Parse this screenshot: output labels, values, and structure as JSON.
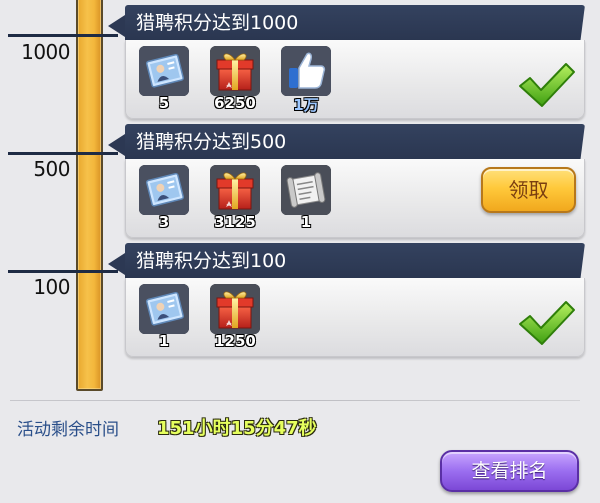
{
  "milestones": [
    {
      "score": "1000",
      "title": "猎聘积分达到1000",
      "status": "claimed",
      "rewards": [
        {
          "icon": "photo-card-icon",
          "qty": "5"
        },
        {
          "icon": "gift-box-icon",
          "qty": "6250"
        },
        {
          "icon": "thumbs-up-icon",
          "qty": "1万"
        }
      ]
    },
    {
      "score": "500",
      "title": "猎聘积分达到500",
      "status": "claimable",
      "claim_label": "领取",
      "rewards": [
        {
          "icon": "photo-card-icon",
          "qty": "3"
        },
        {
          "icon": "gift-box-icon",
          "qty": "3125"
        },
        {
          "icon": "scroll-icon",
          "qty": "1"
        }
      ]
    },
    {
      "score": "100",
      "title": "猎聘积分达到100",
      "status": "claimed",
      "rewards": [
        {
          "icon": "photo-card-icon",
          "qty": "1"
        },
        {
          "icon": "gift-box-icon",
          "qty": "1250"
        }
      ]
    }
  ],
  "footer": {
    "time_label": "活动剩余时间",
    "time_value": "151小时15分47秒",
    "ranking_button": "查看排名"
  },
  "colors": {
    "header_bg": "#2c3853",
    "progress_bar": "#f3b73c",
    "claim_button": "#ffc93b",
    "ranking_button": "#9b6ef0",
    "check_green": "#6cc51c"
  }
}
